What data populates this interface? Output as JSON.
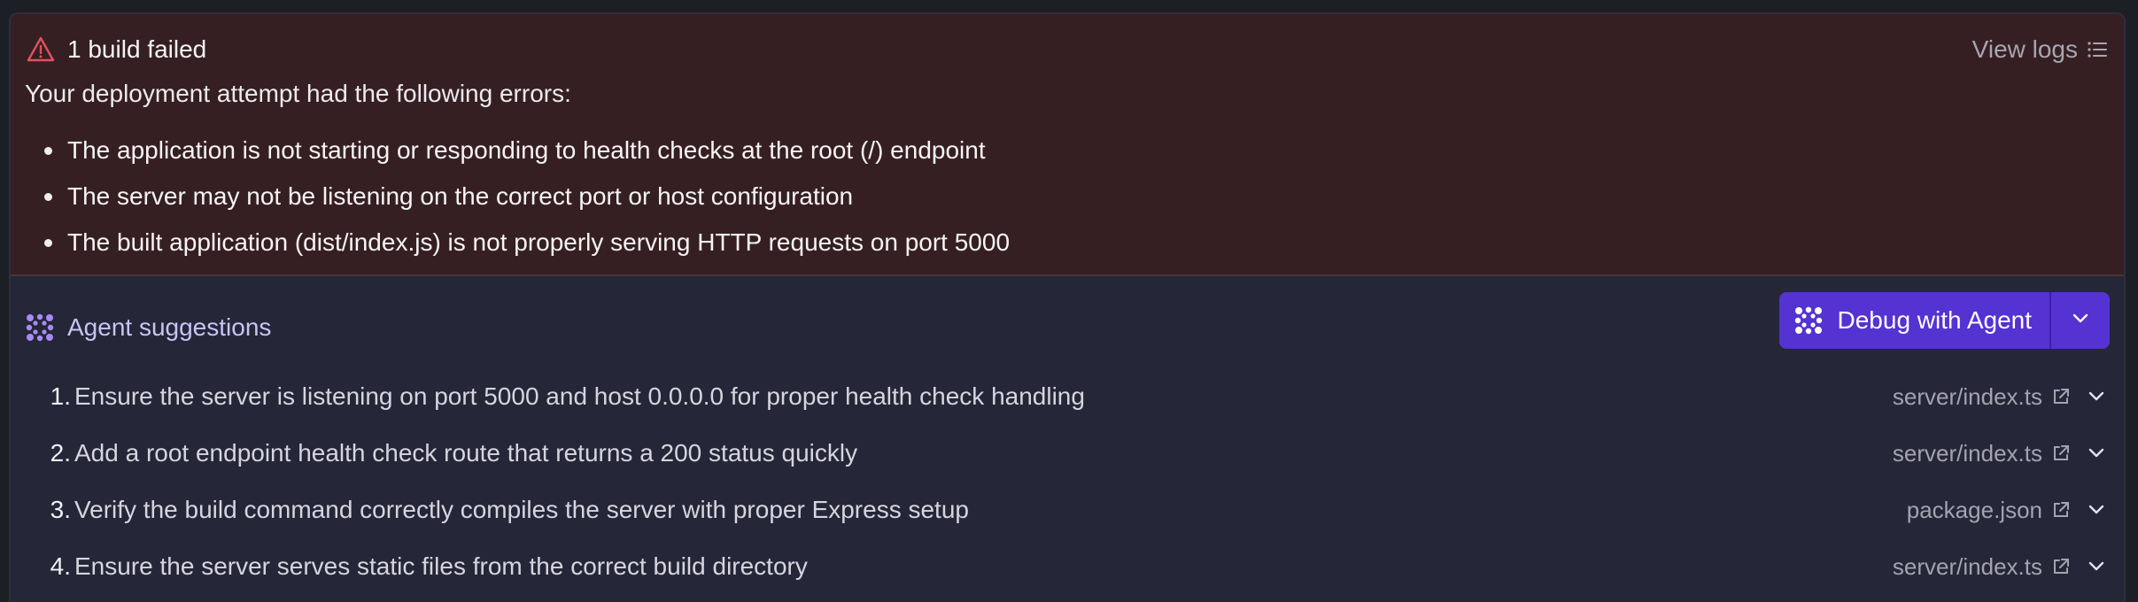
{
  "error": {
    "title": "1 build failed",
    "view_logs": "View logs",
    "intro": "Your deployment attempt had the following errors:",
    "items": [
      "The application is not starting or responding to health checks at the root (/) endpoint",
      "The server may not be listening on the correct port or host configuration",
      "The built application (dist/index.js) is not properly serving HTTP requests on port 5000"
    ],
    "icon": "warning-triangle-icon",
    "color": "#e0525e"
  },
  "agent": {
    "title": "Agent suggestions",
    "debug_label": "Debug with Agent",
    "accent": "#5532d2",
    "suggestions": [
      {
        "num": "1.",
        "text": "Ensure the server is listening on port 5000 and host 0.0.0.0 for proper health check handling",
        "file": "server/index.ts"
      },
      {
        "num": "2.",
        "text": "Add a root endpoint health check route that returns a 200 status quickly",
        "file": "server/index.ts"
      },
      {
        "num": "3.",
        "text": "Verify the build command correctly compiles the server with proper Express setup",
        "file": "package.json"
      },
      {
        "num": "4.",
        "text": "Ensure the server serves static files from the correct build directory",
        "file": "server/index.ts"
      }
    ]
  }
}
